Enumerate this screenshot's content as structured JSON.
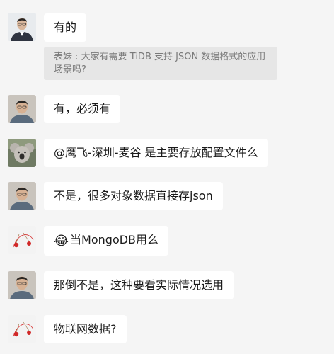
{
  "top_cutoff": "",
  "messages": [
    {
      "avatar": "man-glasses-avatar",
      "text": "有的"
    },
    {
      "quote": "表妹 : 大家有需要 TiDB 支持 JSON 数据格式的应用场景吗?"
    },
    {
      "avatar": "man-avatar",
      "text": "有，必须有"
    },
    {
      "avatar": "koala-avatar",
      "text": "@鹰飞-深圳-麦谷 是主要存放配置文件么"
    },
    {
      "avatar": "man-avatar",
      "text": "不是，很多对象数据直接存json"
    },
    {
      "avatar": "cherry-drawing-avatar",
      "emoji": "😂",
      "text": "当MongoDB用么"
    },
    {
      "avatar": "man-avatar",
      "text": "那倒不是，这种要看实际情况选用"
    },
    {
      "avatar": "cherry-drawing-avatar",
      "text": "物联网数据?"
    }
  ]
}
